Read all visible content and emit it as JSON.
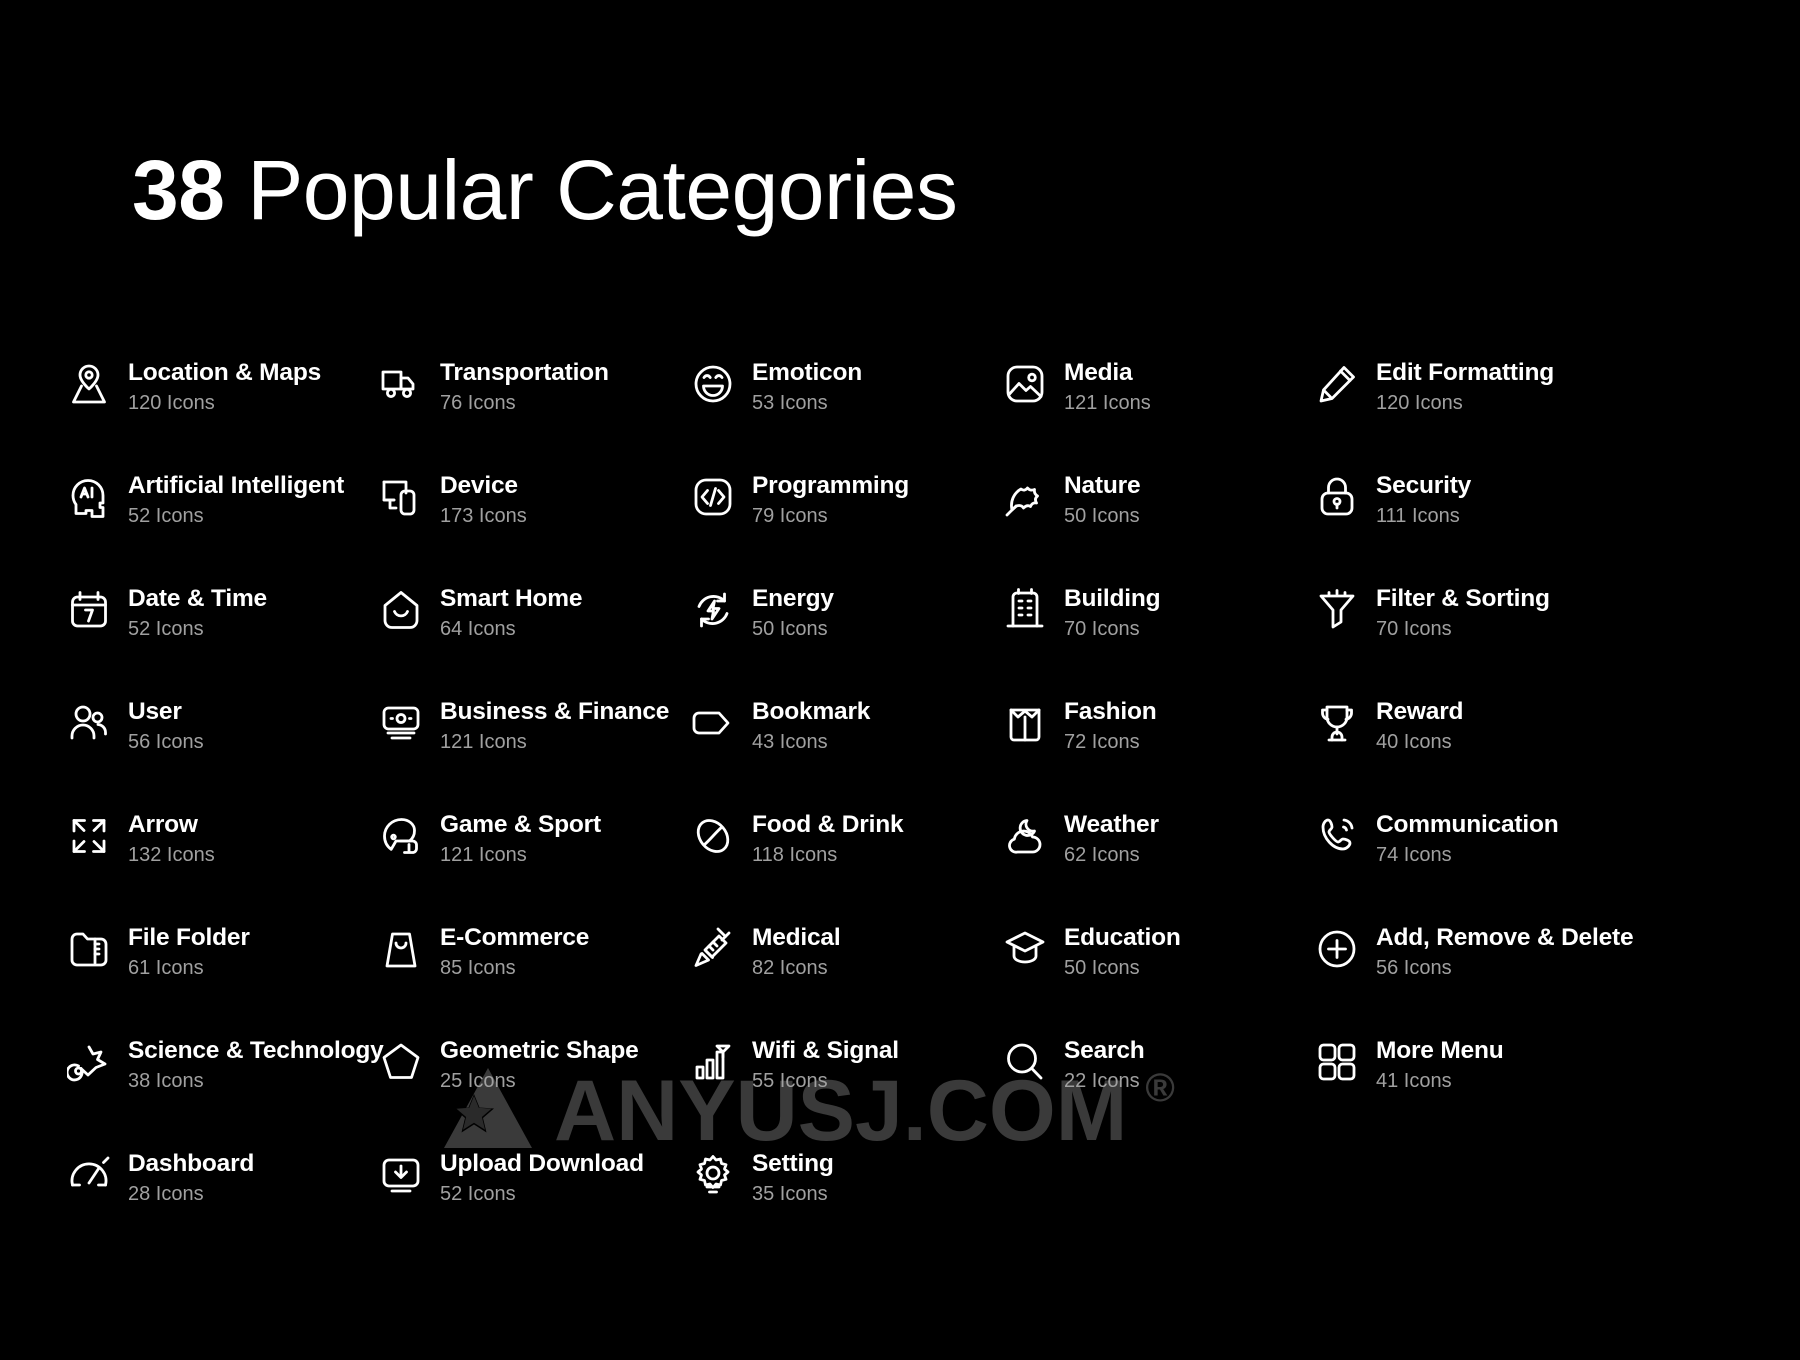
{
  "title": {
    "count": "38",
    "rest": " Popular Categories",
    "full": "38 Popular Categories"
  },
  "watermark": {
    "text": "ANYUSJ.COM",
    "registered": "®",
    "logo_name": "anyusj-triangle-star-logo",
    "color": "#3a3a3a"
  },
  "theme": {
    "background": "#000000",
    "label_color": "#ffffff",
    "count_color": "#a0a0a0",
    "icon_color": "#ffffff"
  },
  "count_suffix": "Icons",
  "categories": [
    {
      "label": "Location & Maps",
      "count": "120 Icons",
      "icon": "location-pin-icon"
    },
    {
      "label": "Transportation",
      "count": "76 Icons",
      "icon": "truck-icon"
    },
    {
      "label": "Emoticon",
      "count": "53 Icons",
      "icon": "smiley-face-icon"
    },
    {
      "label": "Media",
      "count": "121 Icons",
      "icon": "image-picture-icon"
    },
    {
      "label": "Edit Formatting",
      "count": "120 Icons",
      "icon": "pencil-icon"
    },
    {
      "label": "Artificial Intelligent",
      "count": "52 Icons",
      "icon": "ai-head-icon"
    },
    {
      "label": "Device",
      "count": "173 Icons",
      "icon": "monitor-phone-icon"
    },
    {
      "label": "Programming",
      "count": "79 Icons",
      "icon": "code-brackets-icon"
    },
    {
      "label": "Nature",
      "count": "50 Icons",
      "icon": "leaf-icon"
    },
    {
      "label": "Security",
      "count": "111 Icons",
      "icon": "lock-icon"
    },
    {
      "label": "Date & Time",
      "count": "52 Icons",
      "icon": "calendar-icon"
    },
    {
      "label": "Smart Home",
      "count": "64 Icons",
      "icon": "smart-home-icon"
    },
    {
      "label": "Energy",
      "count": "50 Icons",
      "icon": "energy-bolt-icon"
    },
    {
      "label": "Building",
      "count": "70 Icons",
      "icon": "building-icon"
    },
    {
      "label": "Filter & Sorting",
      "count": "70 Icons",
      "icon": "filter-funnel-icon"
    },
    {
      "label": "User",
      "count": "56 Icons",
      "icon": "users-icon"
    },
    {
      "label": "Business & Finance",
      "count": "121 Icons",
      "icon": "banknote-icon"
    },
    {
      "label": "Bookmark",
      "count": "43 Icons",
      "icon": "tag-bookmark-icon"
    },
    {
      "label": "Fashion",
      "count": "72 Icons",
      "icon": "shirt-icon"
    },
    {
      "label": "Reward",
      "count": "40 Icons",
      "icon": "trophy-icon"
    },
    {
      "label": "Arrow",
      "count": "132 Icons",
      "icon": "four-arrows-icon"
    },
    {
      "label": "Game & Sport",
      "count": "121 Icons",
      "icon": "football-helmet-icon"
    },
    {
      "label": "Food & Drink",
      "count": "118 Icons",
      "icon": "coffee-bean-icon"
    },
    {
      "label": "Weather",
      "count": "62 Icons",
      "icon": "cloud-moon-icon"
    },
    {
      "label": "Communication",
      "count": "74 Icons",
      "icon": "phone-call-icon"
    },
    {
      "label": "File Folder",
      "count": "61 Icons",
      "icon": "folder-zip-icon"
    },
    {
      "label": "E-Commerce",
      "count": "85 Icons",
      "icon": "shopping-bag-icon"
    },
    {
      "label": "Medical",
      "count": "82 Icons",
      "icon": "syringe-icon"
    },
    {
      "label": "Education",
      "count": "50 Icons",
      "icon": "graduation-cap-icon"
    },
    {
      "label": "Add, Remove & Delete",
      "count": "56 Icons",
      "icon": "plus-circle-icon"
    },
    {
      "label": "Science & Technology",
      "count": "38 Icons",
      "icon": "comet-icon"
    },
    {
      "label": "Geometric Shape",
      "count": "25 Icons",
      "icon": "pentagon-icon"
    },
    {
      "label": "Wifi & Signal",
      "count": "55 Icons",
      "icon": "signal-bars-icon"
    },
    {
      "label": "Search",
      "count": "22 Icons",
      "icon": "magnifier-icon"
    },
    {
      "label": "More Menu",
      "count": "41 Icons",
      "icon": "grid-four-squares-icon"
    },
    {
      "label": "Dashboard",
      "count": "28 Icons",
      "icon": "speedometer-icon"
    },
    {
      "label": "Upload Download",
      "count": "52 Icons",
      "icon": "download-box-icon"
    },
    {
      "label": "Setting",
      "count": "35 Icons",
      "icon": "gear-icon"
    }
  ]
}
